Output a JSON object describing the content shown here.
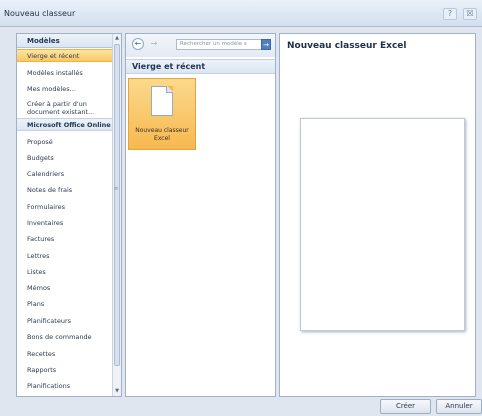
{
  "window": {
    "title": "Nouveau classeur",
    "help_glyph": "?",
    "close_glyph": "☒"
  },
  "left_panel": {
    "header": "Modèles",
    "items": [
      {
        "label": "Vierge et récent",
        "selected": true
      },
      {
        "label": "Modèles installés"
      },
      {
        "label": "Mes modèles..."
      },
      {
        "label": "Créer à partir d'un",
        "label2": "document existant..."
      },
      {
        "label": "Microsoft Office Online",
        "group": true
      },
      {
        "label": "Proposé"
      },
      {
        "label": "Budgets"
      },
      {
        "label": "Calendriers"
      },
      {
        "label": "Notes de frais"
      },
      {
        "label": "Formulaires"
      },
      {
        "label": "Inventaires"
      },
      {
        "label": "Factures"
      },
      {
        "label": "Lettres"
      },
      {
        "label": "Listes"
      },
      {
        "label": "Mémos"
      },
      {
        "label": "Plans"
      },
      {
        "label": "Planificateurs"
      },
      {
        "label": "Bons de commande"
      },
      {
        "label": "Recettes"
      },
      {
        "label": "Rapports"
      },
      {
        "label": "Planifications"
      }
    ]
  },
  "middle_panel": {
    "search_placeholder": "Rechercher un modèle s",
    "section_title": "Vierge et récent",
    "tile_label_line1": "Nouveau classeur",
    "tile_label_line2": "Excel"
  },
  "right_panel": {
    "title": "Nouveau classeur Excel"
  },
  "footer": {
    "create": "Créer",
    "cancel": "Annuler"
  },
  "colors": {
    "selection": "#f9c862",
    "panel_border": "#9fb1c9",
    "search_button": "#4f7fbf"
  }
}
